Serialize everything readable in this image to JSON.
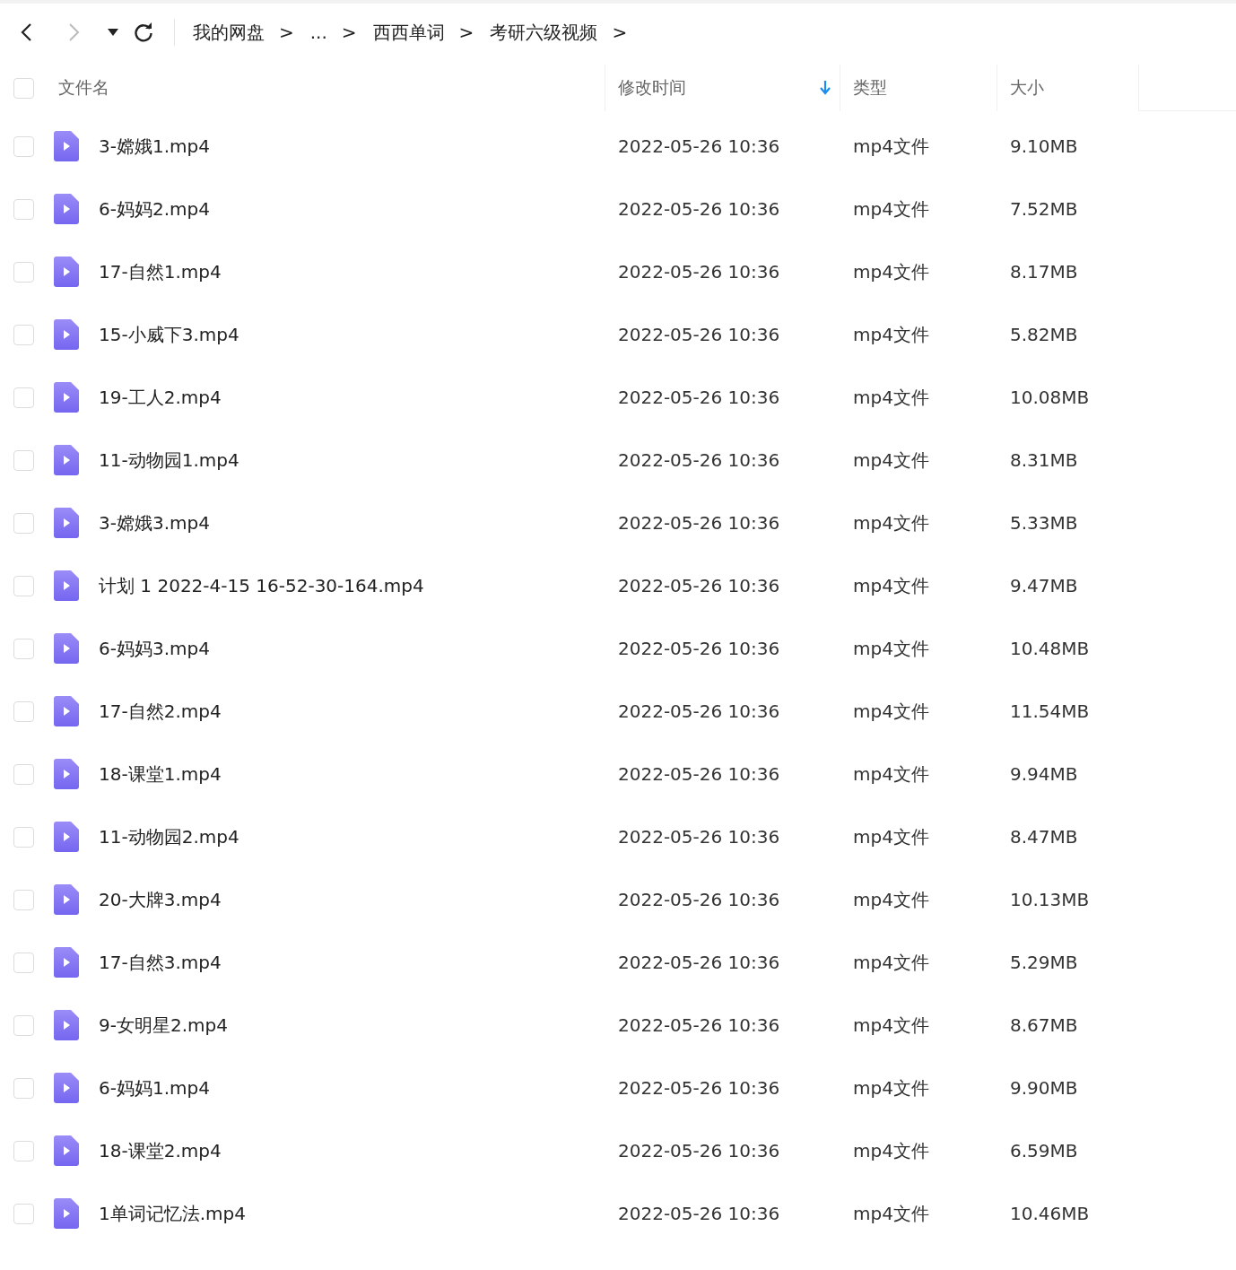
{
  "toolbar": {
    "back": {
      "disabled": false
    },
    "forward": {
      "disabled": true
    },
    "breadcrumbs": [
      {
        "label": "我的网盘"
      },
      {
        "label": "..."
      },
      {
        "label": "西西单词"
      },
      {
        "label": "考研六级视频"
      }
    ],
    "separator": ">"
  },
  "table": {
    "select_all": {
      "checked": false
    },
    "columns": [
      {
        "label": "文件名",
        "sorted": false
      },
      {
        "label": "修改时间",
        "sorted": true
      },
      {
        "label": "类型",
        "sorted": false
      },
      {
        "label": "大小",
        "sorted": false
      }
    ],
    "rows": [
      {
        "checked": false,
        "name": "3-嫦娥1.mp4",
        "modified": "2022-05-26 10:36",
        "type": "mp4文件",
        "size": "9.10MB"
      },
      {
        "checked": false,
        "name": "6-妈妈2.mp4",
        "modified": "2022-05-26 10:36",
        "type": "mp4文件",
        "size": "7.52MB"
      },
      {
        "checked": false,
        "name": "17-自然1.mp4",
        "modified": "2022-05-26 10:36",
        "type": "mp4文件",
        "size": "8.17MB"
      },
      {
        "checked": false,
        "name": "15-小威下3.mp4",
        "modified": "2022-05-26 10:36",
        "type": "mp4文件",
        "size": "5.82MB"
      },
      {
        "checked": false,
        "name": "19-工人2.mp4",
        "modified": "2022-05-26 10:36",
        "type": "mp4文件",
        "size": "10.08MB"
      },
      {
        "checked": false,
        "name": "11-动物园1.mp4",
        "modified": "2022-05-26 10:36",
        "type": "mp4文件",
        "size": "8.31MB"
      },
      {
        "checked": false,
        "name": "3-嫦娥3.mp4",
        "modified": "2022-05-26 10:36",
        "type": "mp4文件",
        "size": "5.33MB"
      },
      {
        "checked": false,
        "name": "计划 1 2022-4-15 16-52-30-164.mp4",
        "modified": "2022-05-26 10:36",
        "type": "mp4文件",
        "size": "9.47MB"
      },
      {
        "checked": false,
        "name": "6-妈妈3.mp4",
        "modified": "2022-05-26 10:36",
        "type": "mp4文件",
        "size": "10.48MB"
      },
      {
        "checked": false,
        "name": "17-自然2.mp4",
        "modified": "2022-05-26 10:36",
        "type": "mp4文件",
        "size": "11.54MB"
      },
      {
        "checked": false,
        "name": "18-课堂1.mp4",
        "modified": "2022-05-26 10:36",
        "type": "mp4文件",
        "size": "9.94MB"
      },
      {
        "checked": false,
        "name": "11-动物园2.mp4",
        "modified": "2022-05-26 10:36",
        "type": "mp4文件",
        "size": "8.47MB"
      },
      {
        "checked": false,
        "name": "20-大牌3.mp4",
        "modified": "2022-05-26 10:36",
        "type": "mp4文件",
        "size": "10.13MB"
      },
      {
        "checked": false,
        "name": "17-自然3.mp4",
        "modified": "2022-05-26 10:36",
        "type": "mp4文件",
        "size": "5.29MB"
      },
      {
        "checked": false,
        "name": "9-女明星2.mp4",
        "modified": "2022-05-26 10:36",
        "type": "mp4文件",
        "size": "8.67MB"
      },
      {
        "checked": false,
        "name": "6-妈妈1.mp4",
        "modified": "2022-05-26 10:36",
        "type": "mp4文件",
        "size": "9.90MB"
      },
      {
        "checked": false,
        "name": "18-课堂2.mp4",
        "modified": "2022-05-26 10:36",
        "type": "mp4文件",
        "size": "6.59MB"
      },
      {
        "checked": false,
        "name": "1单词记忆法.mp4",
        "modified": "2022-05-26 10:36",
        "type": "mp4文件",
        "size": "10.46MB"
      }
    ]
  }
}
